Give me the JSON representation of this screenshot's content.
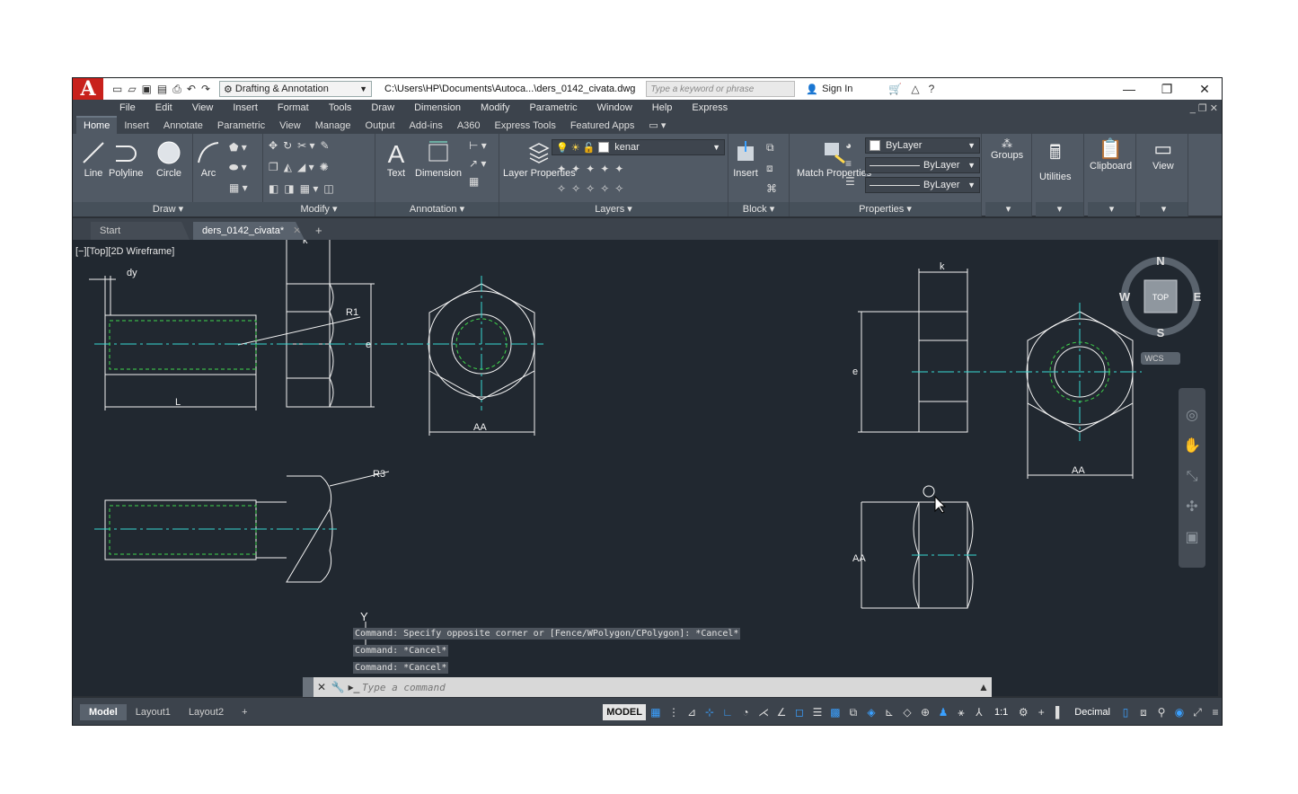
{
  "titlebar": {
    "logo": "A",
    "workspace": "Drafting & Annotation",
    "file_path": "C:\\Users\\HP\\Documents\\Autoca...\\ders_0142_civata.dwg",
    "search_placeholder": "Type a keyword or phrase",
    "sign_in": "Sign In"
  },
  "menubar": [
    "File",
    "Edit",
    "View",
    "Insert",
    "Format",
    "Tools",
    "Draw",
    "Dimension",
    "Modify",
    "Parametric",
    "Window",
    "Help",
    "Express"
  ],
  "ribbon_tabs": [
    "Home",
    "Insert",
    "Annotate",
    "Parametric",
    "View",
    "Manage",
    "Output",
    "Add-ins",
    "A360",
    "Express Tools",
    "Featured Apps"
  ],
  "ribbon": {
    "draw": {
      "title": "Draw",
      "tools": [
        "Line",
        "Polyline",
        "Circle",
        "Arc"
      ]
    },
    "modify": {
      "title": "Modify"
    },
    "annotation": {
      "title": "Annotation",
      "tools": [
        "Text",
        "Dimension"
      ]
    },
    "layers": {
      "title": "Layers",
      "layer_name": "kenar",
      "tool": "Layer Properties"
    },
    "block": {
      "title": "Block",
      "tool": "Insert"
    },
    "properties": {
      "title": "Properties",
      "tool": "Match Properties",
      "color": "ByLayer",
      "linetype": "ByLayer",
      "lineweight": "ByLayer"
    },
    "groups": "Groups",
    "utilities": "Utilities",
    "clipboard": "Clipboard",
    "view": "View"
  },
  "doc_tabs": {
    "start": "Start",
    "active": "ders_0142_civata*"
  },
  "viewport": {
    "controls": "[−][Top][2D Wireframe]"
  },
  "viewcube": {
    "n": "N",
    "s": "S",
    "e": "E",
    "w": "W",
    "face": "TOP",
    "ucs": "WCS"
  },
  "drawing_labels": {
    "dy": "dy",
    "k_left": "k",
    "r1": "R1",
    "e_left": "e",
    "l": "L",
    "aa_left": "AA",
    "r3": "R3",
    "k_right": "k",
    "e_right": "e",
    "aa_right": "AA",
    "aa_side": "AA",
    "y_axis": "Y"
  },
  "command_history": [
    "Command: Specify opposite corner or [Fence/WPolygon/CPolygon]: *Cancel*",
    "Command: *Cancel*",
    "Command: *Cancel*"
  ],
  "command_placeholder": "Type a command",
  "layout_tabs": [
    "Model",
    "Layout1",
    "Layout2"
  ],
  "status": {
    "model": "MODEL",
    "scale": "1:1",
    "units": "Decimal"
  }
}
